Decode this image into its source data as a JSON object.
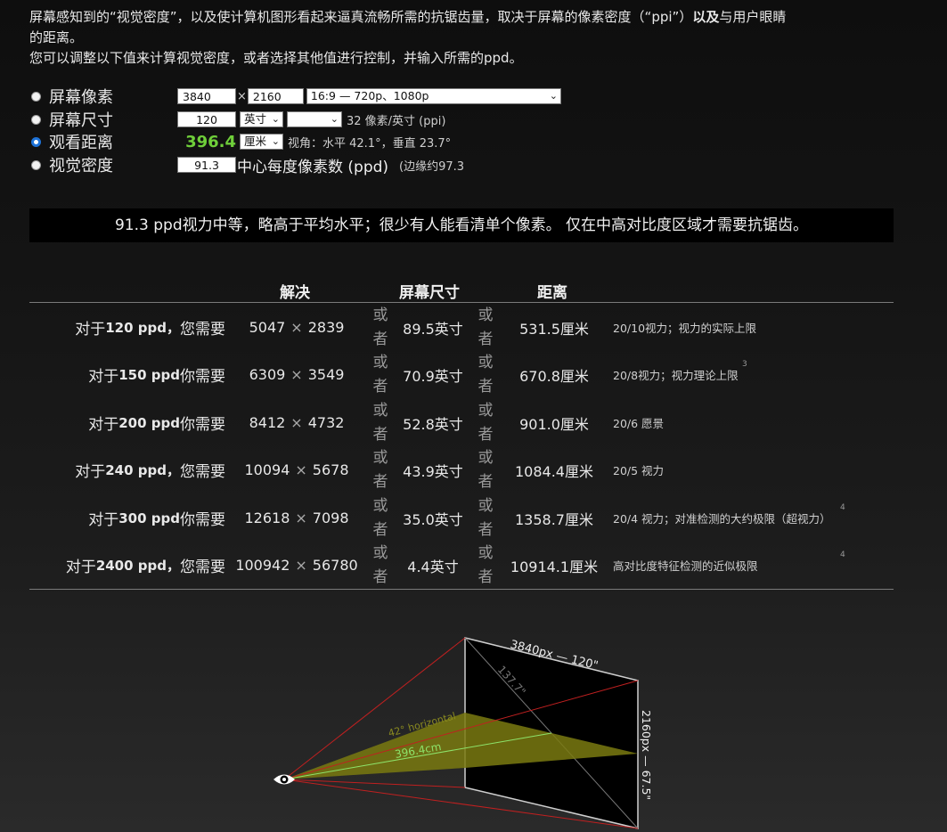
{
  "intro": {
    "line1_a": "屏幕感知到的“视觉密度”，以及使计算机图形看起来逼真流畅所需的抗锯齿量，取决于屏幕的像素密度（“ppi”）",
    "line1_bold": "以及",
    "line1_b": "与用户眼睛",
    "line2": "的距离。",
    "line3": "您可以调整以下值来计算视觉密度，或者选择其他值进行控制，并输入所需的ppd。"
  },
  "controls": {
    "pixels": {
      "label": "屏幕像素",
      "width": "3840",
      "times": "×",
      "height": "2160",
      "preset": "16:9 — 720p、1080p",
      "selected": false
    },
    "size": {
      "label": "屏幕尺寸",
      "value": "120",
      "unit": "英寸",
      "preset": "",
      "ppi_text": "32 像素/英寸 (ppi)",
      "selected": false
    },
    "distance": {
      "label": "观看距离",
      "value": "396.4",
      "unit": "厘米",
      "angle_text": "视角：水平 42.1°，垂直 23.7°",
      "selected": true
    },
    "density": {
      "label": "视觉密度",
      "value": "91.3",
      "ppd_text": "中心每度像素数 (ppd)",
      "edge_text": "(边缘约97.3",
      "selected": false
    }
  },
  "banner": "91.3 ppd视力中等，略高于平均水平；很少有人能看清单个像素。 仅在中高对比度区域才需要抗锯齿。",
  "table": {
    "headers": {
      "resolution": "解决",
      "size": "屏幕尺寸",
      "distance": "距离"
    },
    "or_text": [
      "或",
      "者"
    ],
    "times": "×",
    "rows": [
      {
        "pre": "对于",
        "ppd": "120 ppd，",
        "post": "您需要",
        "w": "5047",
        "h": "2839",
        "size": "89.5英寸",
        "dist": "531.5厘米",
        "note": "20/10视力；视力的实际上限",
        "sup": ""
      },
      {
        "pre": "对于",
        "ppd": "150 ppd",
        "post": "你需要",
        "w": "6309",
        "h": "3549",
        "size": "70.9英寸",
        "dist": "670.8厘米",
        "note": "20/8视力；视力理论上限",
        "sup": "3"
      },
      {
        "pre": "对于",
        "ppd": "200 ppd",
        "post": "你需要",
        "w": "8412",
        "h": "4732",
        "size": "52.8英寸",
        "dist": "901.0厘米",
        "note": "20/6 愿景",
        "sup": ""
      },
      {
        "pre": "对于",
        "ppd": "240 ppd，",
        "post": "您需要",
        "w": "10094",
        "h": "5678",
        "size": "43.9英寸",
        "dist": "1084.4厘米",
        "note": "20/5 视力",
        "sup": ""
      },
      {
        "pre": "对于",
        "ppd": "300 ppd",
        "post": "你需要",
        "w": "12618",
        "h": "7098",
        "size": "35.0英寸",
        "dist": "1358.7厘米",
        "note": "20/4 视力；对准检测的大约极限（超视力）",
        "sup": "4"
      },
      {
        "pre": "对于",
        "ppd": "2400 ppd，",
        "post": "您需要",
        "w": "100942",
        "h": "56780",
        "size": "4.4英寸",
        "dist": "10914.1厘米",
        "note": "高对比度特征检测的近似极限",
        "sup": "4"
      }
    ]
  },
  "diagram": {
    "top_label": "3840px — 120\"",
    "diag_label": "137.7\"",
    "side_label": "2160px — 67.5\"",
    "angle_label": "42° horizontal",
    "dist_label": "396.4cm",
    "colors": {
      "view_lines": "#c02020",
      "cone": "#7a7a10",
      "center_line": "#8de36a",
      "screen": "#000000"
    }
  }
}
